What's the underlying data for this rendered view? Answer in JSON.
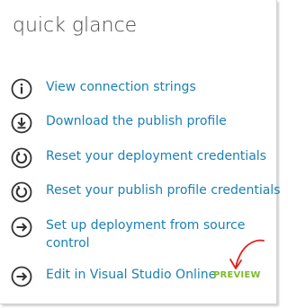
{
  "title": "quick glance",
  "items": [
    {
      "label": "View connection strings",
      "icon": "info-icon"
    },
    {
      "label": "Download the publish profile",
      "icon": "download-icon"
    },
    {
      "label": "Reset your deployment credentials",
      "icon": "reset-icon"
    },
    {
      "label": "Reset your publish profile credentials",
      "icon": "reset-icon"
    },
    {
      "label": "Set up deployment from source control",
      "icon": "arrow-right-icon"
    },
    {
      "label": "Edit in Visual Studio Online",
      "icon": "arrow-right-icon"
    }
  ],
  "badge": "PREVIEW",
  "colors": {
    "link": "#1a81b5",
    "title": "#4a4a4a",
    "preview": "#7ebc2c",
    "annotation": "#e02020",
    "icon": "#333333"
  }
}
